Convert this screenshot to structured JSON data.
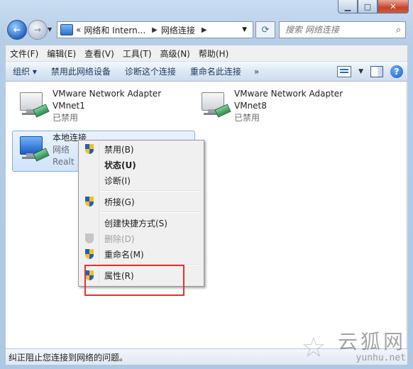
{
  "window": {
    "controls": {
      "minimize": "▁",
      "maximize": "□",
      "close": "✕"
    }
  },
  "nav": {
    "back_icon": "arrow-left",
    "forward_icon": "arrow-right",
    "breadcrumb": [
      "«",
      "网络和 Intern...",
      "网络连接"
    ],
    "refresh_icon": "refresh",
    "search_placeholder": "搜索 网络连接"
  },
  "menu": [
    "文件(F)",
    "编辑(E)",
    "查看(V)",
    "工具(T)",
    "高级(N)",
    "帮助(H)"
  ],
  "commands": {
    "organize": "组织 ▾",
    "disable": "禁用此网络设备",
    "diagnose": "诊断这个连接",
    "rename": "重命名此连接",
    "more": "»"
  },
  "adapters": [
    {
      "name": "VMware Network Adapter",
      "sub": "VMnet1",
      "status": "已禁用"
    },
    {
      "name": "VMware Network Adapter",
      "sub": "VMnet8",
      "status": "已禁用"
    },
    {
      "name": "本地连接",
      "sub": "网络",
      "status": "Realt"
    }
  ],
  "context_menu": [
    {
      "label": "禁用(B)",
      "shield": true
    },
    {
      "label": "状态(U)",
      "bold": true
    },
    {
      "label": "诊断(I)"
    },
    {
      "label": "桥接(G)",
      "shield": true
    },
    {
      "label": "创建快捷方式(S)"
    },
    {
      "label": "删除(D)",
      "shield": true,
      "disabled": true
    },
    {
      "label": "重命名(M)",
      "shield": true
    },
    {
      "label": "属性(R)",
      "shield": true
    }
  ],
  "status_text": "纠正阻止您连接到网络的问题。",
  "watermark": {
    "cn": "云狐网",
    "en": "yunhu.net"
  },
  "colors": {
    "highlight": "#e0332f",
    "selection": "#d0e3fa"
  }
}
